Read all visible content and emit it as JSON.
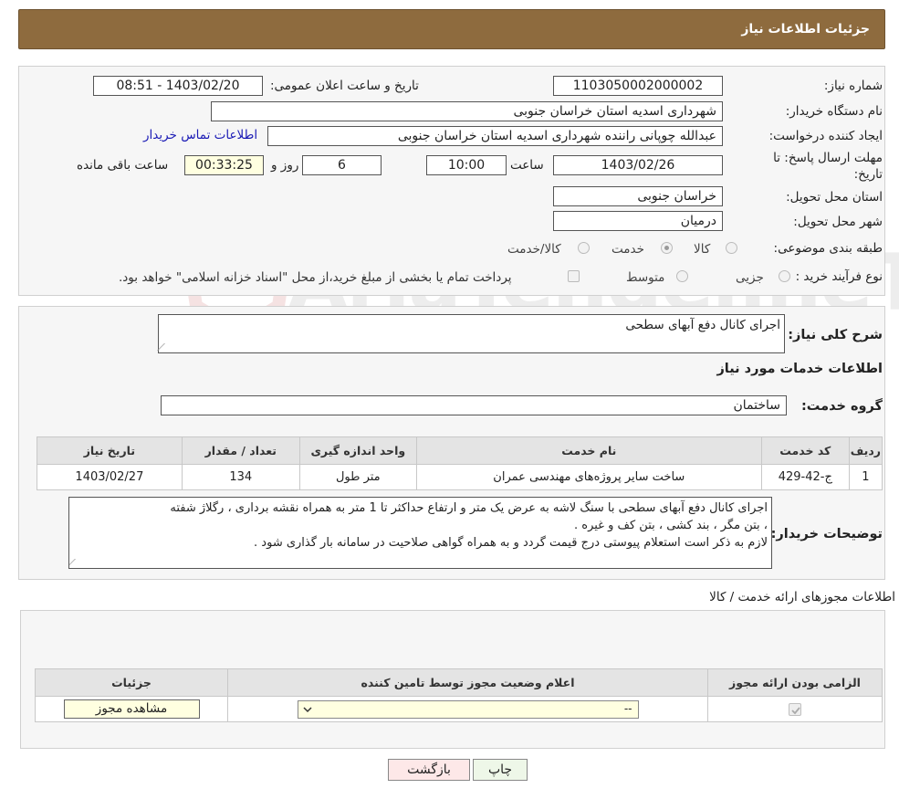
{
  "header": {
    "title": "جزئیات اطلاعات نیاز"
  },
  "details": {
    "need_number_label": "شماره نیاز:",
    "need_number": "1103050002000002",
    "announce_label": "تاریخ و ساعت اعلان عمومی:",
    "announce_value": "1403/02/20 - 08:51",
    "buyer_org_label": "نام دستگاه خریدار:",
    "buyer_org": "شهرداری اسدیه استان خراسان جنوبی",
    "requester_label": "ایجاد کننده درخواست:",
    "requester": "عبدالله چوپانی راننده شهرداری اسدیه استان خراسان جنوبی",
    "contact_link": "اطلاعات تماس خریدار",
    "deadline_label_1": "مهلت ارسال پاسخ: تا",
    "deadline_label_2": "تاریخ:",
    "deadline_date": "1403/02/26",
    "time_label": "ساعت",
    "deadline_time": "10:00",
    "days_value": "6",
    "days_label": "روز و",
    "remaining_time": "00:33:25",
    "remaining_label": "ساعت باقی مانده",
    "delivery_province_label": "استان محل تحویل:",
    "delivery_province": "خراسان جنوبی",
    "delivery_city_label": "شهر محل تحویل:",
    "delivery_city": "درمیان",
    "category_label": "طبقه بندی موضوعی:",
    "category_options": [
      "کالا",
      "خدمت",
      "کالا/خدمت"
    ],
    "category_selected": "خدمت",
    "process_label": "نوع فرآیند خرید :",
    "process_options": [
      "جزیی",
      "متوسط"
    ],
    "payment_note": "پرداخت تمام یا بخشی از مبلغ خرید،از محل \"اسناد خزانه اسلامی\" خواهد بود."
  },
  "need": {
    "summary_label": "شرح کلی نیاز:",
    "summary": "اجرای کانال دفع آبهای سطحی",
    "services_heading": "اطلاعات خدمات مورد نیاز",
    "service_group_label": "گروه خدمت:",
    "service_group": "ساختمان",
    "table": {
      "headers": [
        "ردیف",
        "کد خدمت",
        "نام خدمت",
        "واحد اندازه گیری",
        "تعداد / مقدار",
        "تاریخ نیاز"
      ],
      "rows": [
        [
          "1",
          "ج-42-429",
          "ساخت سایر پروژه‌های مهندسی عمران",
          "متر طول",
          "134",
          "1403/02/27"
        ]
      ]
    },
    "buyer_notes_label": "توضیحات خریدار:",
    "buyer_notes_1": "اجرای کانال دفع آبهای سطحی با سنگ لاشه به عرض یک متر و ارتفاع حداکثر تا 1 متر به همراه نقشه برداری ، رگلاژ شفته",
    "buyer_notes_2": "، بتن مگر ، بند کشی ، بتن کف و غیره .",
    "buyer_notes_3": "لازم به ذکر است استعلام پیوستی درج قیمت گردد و به همراه گواهی صلاحیت در سامانه بار گذاری شود ."
  },
  "permits": {
    "heading": "اطلاعات مجوزهای ارائه خدمت / کالا",
    "headers": [
      "الزامی بودن ارائه مجوز",
      "اعلام وضعیت مجوز توسط تامین کننده",
      "جزئیات"
    ],
    "select_value": "--",
    "view_button": "مشاهده مجوز"
  },
  "buttons": {
    "print": "چاپ",
    "back": "بازگشت"
  },
  "colors": {
    "header_bg": "#8e6b3e",
    "back_button_bg": "#fde8e8",
    "print_button_bg": "#eef7e8"
  }
}
